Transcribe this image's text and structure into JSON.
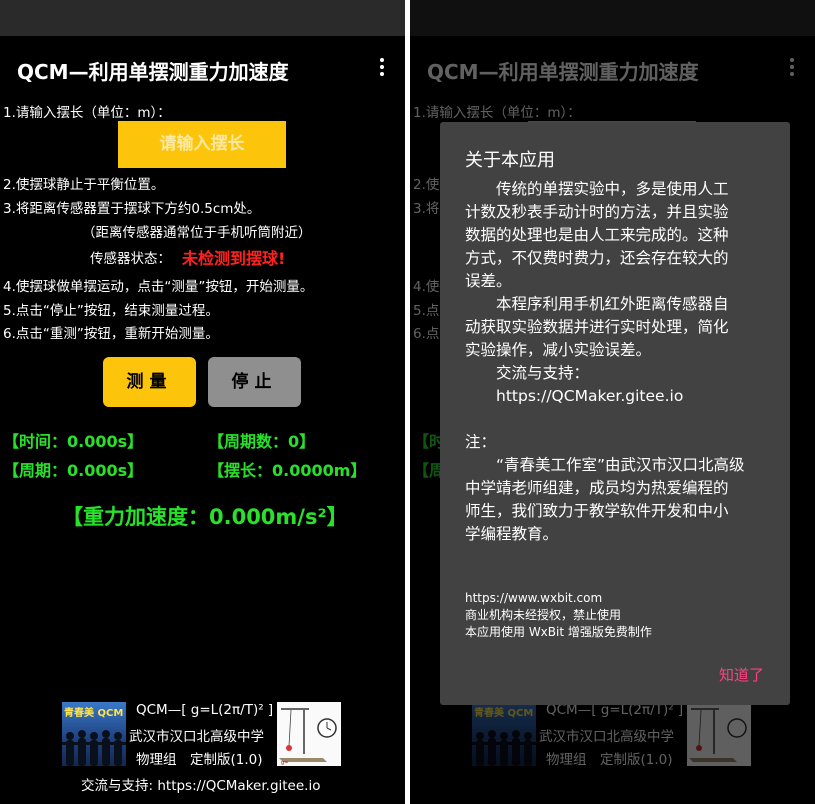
{
  "app": {
    "title": "QCM—利用单摆测重力加速度"
  },
  "steps": {
    "step1": "1.请输入摆长（单位：m）：",
    "input_placeholder": "请输入摆长",
    "step2": "2.使摆球静止于平衡位置。",
    "step3": "3.将距离传感器置于摆球下方约0.5cm处。",
    "step3_note": "（距离传感器通常位于手机听筒附近）",
    "sensor_label": "传感器状态：",
    "sensor_value": "未检测到摆球!",
    "step4": "4.使摆球做单摆运动，点击“测量”按钮，开始测量。",
    "step5": "5.点击“停止”按钮，结束测量过程。",
    "step6": "6.点击“重测”按钮，重新开始测量。"
  },
  "buttons": {
    "measure": "测量",
    "stop": "停止"
  },
  "readings": {
    "time": "【时间：0.000s】",
    "cycles": "【周期数：0】",
    "period": "【周期：0.000s】",
    "length": "【摆长：0.0000m】",
    "gravity": "【重力加速度：0.000m/s²】"
  },
  "footer": {
    "logo_text": "青春美 QCM",
    "formula": "QCM—[ g=L(2π/T)² ]",
    "school": "武汉市汉口北高级中学",
    "group": "物理组　定制版(1.0)",
    "support": "交流与支持: https://QCMaker.gitee.io"
  },
  "dialog": {
    "title": "关于本应用",
    "body_lines": [
      "　　传统的单摆实验中，多是使用人工",
      "计数及秒表手动计时的方法，并且实验",
      "数据的处理也是由人工来完成的。这种",
      "方式，不仅费时费力，还会存在较大的",
      "误差。",
      "　　本程序利用手机红外距离传感器自",
      "动获取实验数据并进行实时处理，简化",
      "实验操作，减小实验误差。",
      "　　交流与支持：",
      "　　https://QCMaker.gitee.io",
      "",
      "注：",
      "　　“青春美工作室”由武汉市汉口北高级",
      "中学靖老师组建，成员均为热爱编程的",
      "师生，我们致力于教学软件开发和中小",
      "学编程教育。"
    ],
    "small_lines": [
      "https://www.wxbit.com",
      "商业机构未经授权，禁止使用",
      "本应用使用 WxBit 增强版免费制作"
    ],
    "ok": "知道了"
  },
  "colors": {
    "accent_yellow": "#fcc40b",
    "status_red": "#ff2020",
    "reading_green": "#28e22a",
    "dialog_bg": "#424242",
    "dialog_ok": "#ff4081"
  }
}
